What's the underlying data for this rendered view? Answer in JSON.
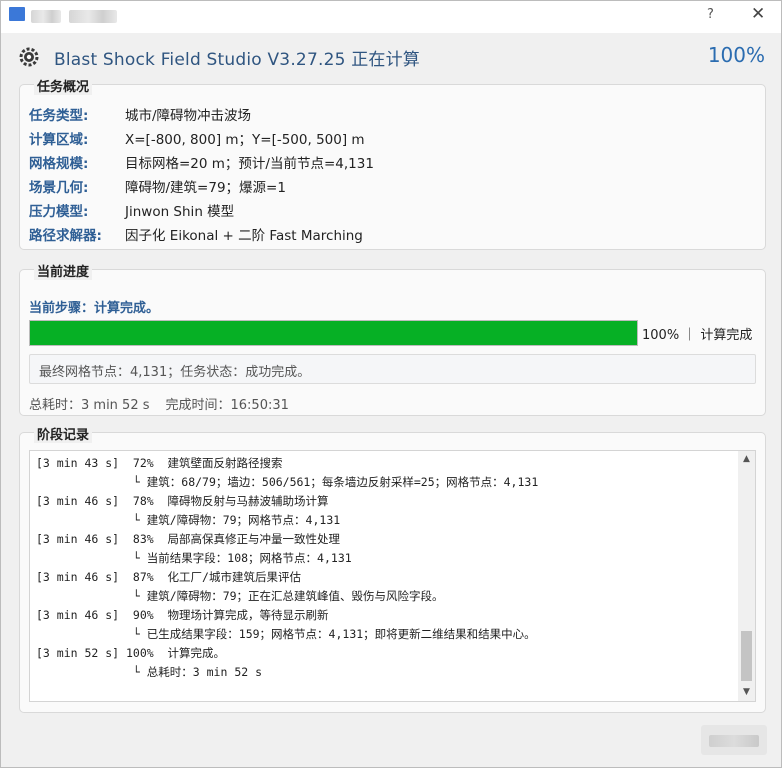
{
  "window": {
    "app_title": "Blast Shock Field Studio V3.27.25 正在计算",
    "percent": "100%",
    "help_glyph": "?",
    "close_glyph": "✕"
  },
  "overview": {
    "title": "任务概况",
    "rows": [
      {
        "label": "任务类型:",
        "value": "城市/障碍物冲击波场"
      },
      {
        "label": "计算区域:",
        "value": "X=[-800, 800] m；Y=[-500, 500] m"
      },
      {
        "label": "网格规模:",
        "value": "目标网格=20 m；预计/当前节点=4,131"
      },
      {
        "label": "场景几何:",
        "value": "障碍物/建筑=79；爆源=1"
      },
      {
        "label": "压力模型:",
        "value": "Jinwon Shin 模型"
      },
      {
        "label": "路径求解器:",
        "value": "因子化 Eikonal + 二阶 Fast Marching"
      }
    ]
  },
  "progress": {
    "title": "当前进度",
    "step_text": "当前步骤：计算完成。",
    "fraction": 1.0,
    "bar_color": "#06b025",
    "status_text": "100% ｜ 计算完成",
    "result_text": "最终网格节点：4,131；任务状态：成功完成。",
    "elapsed": "总耗时：3 min 52 s",
    "finished": "完成时间：16:50:31"
  },
  "log": {
    "title": "阶段记录",
    "lines": [
      "[3 min 43 s]  72%  建筑壁面反射路径搜索",
      "              └ 建筑：68/79；墙边：506/561；每条墙边反射采样=25；网格节点：4,131",
      "[3 min 46 s]  78%  障碍物反射与马赫波辅助场计算",
      "              └ 建筑/障碍物：79；网格节点：4,131",
      "[3 min 46 s]  83%  局部高保真修正与冲量一致性处理",
      "              └ 当前结果字段：108；网格节点：4,131",
      "[3 min 46 s]  87%  化工厂/城市建筑后果评估",
      "              └ 建筑/障碍物：79；正在汇总建筑峰值、毁伤与风险字段。",
      "[3 min 46 s]  90%  物理场计算完成，等待显示刷新",
      "              └ 已生成结果字段：159；网格节点：4,131；即将更新二维结果和结果中心。",
      "[3 min 52 s] 100%  计算完成。",
      "              └ 总耗时：3 min 52 s"
    ]
  },
  "icons": {
    "app": "gear-shield-icon",
    "scroll_up": "chevron-up-icon",
    "scroll_down": "chevron-down-icon"
  }
}
